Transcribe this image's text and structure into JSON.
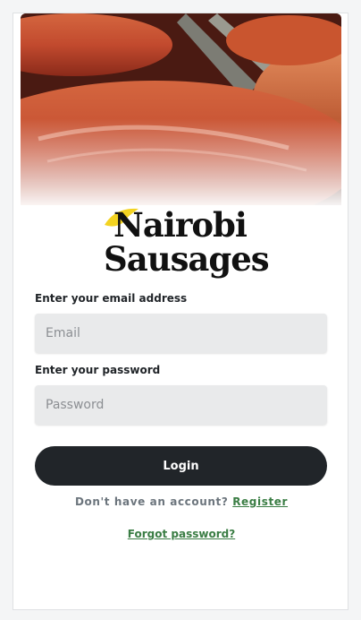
{
  "brand": {
    "line1": "Nairobi",
    "line2": "Sausages",
    "accent_color": "#f3d321"
  },
  "form": {
    "email_label": "Enter your email address",
    "email_placeholder": "Email",
    "password_label": "Enter your password",
    "password_placeholder": "Password",
    "login_label": "Login"
  },
  "footer": {
    "register_prompt": "Don't have an account?",
    "register_link": "Register",
    "forgot_link": "Forgot password?",
    "link_color": "#3a7d44"
  }
}
